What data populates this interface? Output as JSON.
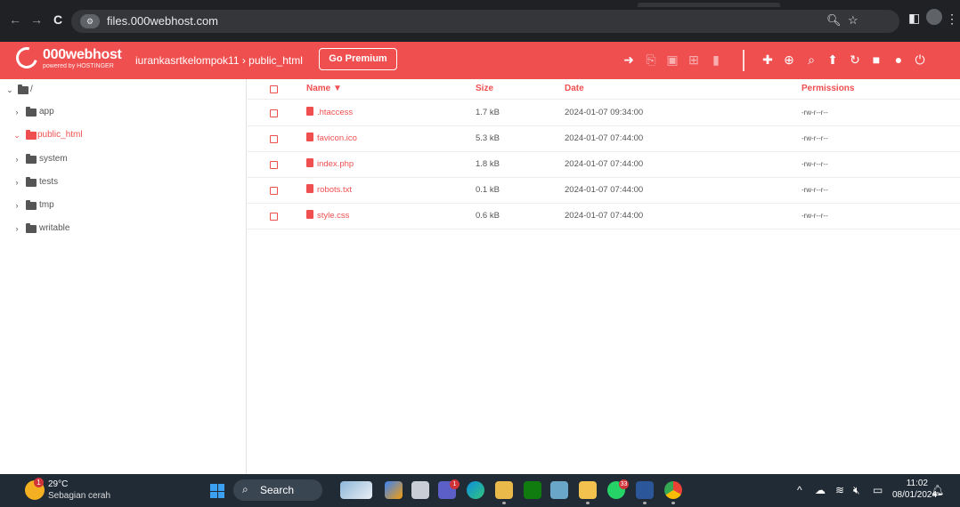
{
  "browser": {
    "url": "files.000webhost.com",
    "nav": {
      "back": "←",
      "forward": "→",
      "reload": "C"
    },
    "site_icon": "site-info-icon"
  },
  "app": {
    "logo_name": "000webhost",
    "logo_sub": "powered by HOSTINGER",
    "breadcrumb": "iurankasrtkelompok11  ›  public_html",
    "premium_button": "Go Premium",
    "brand_color": "#f04f50"
  },
  "tree": {
    "root_label": "/",
    "items": [
      {
        "label": "app",
        "expanded": false
      },
      {
        "label": "public_html",
        "expanded": true
      },
      {
        "label": "system",
        "expanded": false
      },
      {
        "label": "tests",
        "expanded": false
      },
      {
        "label": "tmp",
        "expanded": false
      },
      {
        "label": "writable",
        "expanded": false
      }
    ]
  },
  "table": {
    "headers": {
      "name": "Name ▼",
      "size": "Size",
      "date": "Date",
      "permissions": "Permissions"
    },
    "rows": [
      {
        "name": ".htaccess",
        "size": "1.7 kB",
        "date": "2024-01-07 09:34:00",
        "perm": "-rw-r--r--"
      },
      {
        "name": "favicon.ico",
        "size": "5.3 kB",
        "date": "2024-01-07 07:44:00",
        "perm": "-rw-r--r--"
      },
      {
        "name": "index.php",
        "size": "1.8 kB",
        "date": "2024-01-07 07:44:00",
        "perm": "-rw-r--r--"
      },
      {
        "name": "robots.txt",
        "size": "0.1 kB",
        "date": "2024-01-07 07:44:00",
        "perm": "-rw-r--r--"
      },
      {
        "name": "style.css",
        "size": "0.6 kB",
        "date": "2024-01-07 07:44:00",
        "perm": "-rw-r--r--"
      }
    ]
  },
  "taskbar": {
    "weather_temp": "29°C",
    "weather_cond": "Sebagian cerah",
    "weather_badge": "1",
    "search_label": "Search",
    "whatsapp_badge": "33",
    "teams_badge": "1",
    "time": "11:02",
    "date": "08/01/2024"
  }
}
